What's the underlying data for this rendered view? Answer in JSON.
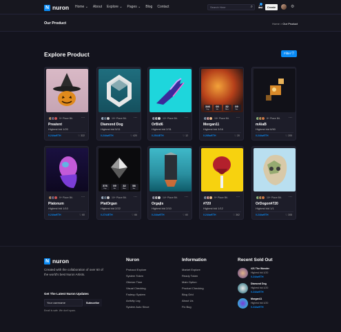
{
  "brand": {
    "name": "nuron",
    "mark": "N"
  },
  "nav": {
    "items": [
      "Home ⌄",
      "About",
      "Explore ⌄",
      "Pages ⌄",
      "Blog",
      "Contact"
    ]
  },
  "search": {
    "placeholder": "Search Here"
  },
  "notifications": {
    "count": "1"
  },
  "create_label": "Create",
  "title_area": {
    "title": "Our Product",
    "crumb_home": "Home",
    "crumb_sep": ">",
    "crumb_current": "Our Product"
  },
  "section": {
    "title": "Explore Product",
    "filter_label": "Filter ⛉"
  },
  "cards": [
    {
      "place": "9+ Place Bit.",
      "name": "Preatent",
      "bid": "Highest bid 1/20",
      "price": "0.244wETH",
      "likes": "♡ 322"
    },
    {
      "place": "10+ Place Bit.",
      "name": "Diamond Dog",
      "bid": "Highest bid 5/11",
      "price": "0.244wETH",
      "likes": "♡ 420"
    },
    {
      "place": "12+ Place Bit.",
      "name": "OrBid6",
      "bid": "Highest bid 2/31",
      "price": "0.2544ETH",
      "likes": "♡ 12"
    },
    {
      "place": "15+ Place Bit.",
      "name": "Morgan11",
      "bid": "Highest bid 3/16",
      "price": "0.265wETH",
      "likes": "♡ 20"
    },
    {
      "place": "8+ Place Bit.",
      "name": "mAiaB",
      "bid": "Highest bid 6/50",
      "price": "0.244wETH",
      "likes": "♡ 205"
    },
    {
      "place": "9+ Place Bit.",
      "name": "Platonum",
      "bid": "Highest bid 1/10",
      "price": "0.244wETH",
      "likes": "♡ 60"
    },
    {
      "place": "10+ Place Bit.",
      "name": "PlatOrgan",
      "bid": "Highest bid 2/22",
      "price": "0.2744ETH",
      "likes": "♡ 66"
    },
    {
      "place": "14+ Place Bit.",
      "name": "Orgajis",
      "bid": "Highest bid 2/10",
      "price": "0.244wETH",
      "likes": "♡ 60"
    },
    {
      "place": "9+ Place Bit.",
      "name": "#720",
      "bid": "Highest bid 1/12",
      "price": "0.244wETH",
      "likes": "♡ 362"
    },
    {
      "place": "10+ Place Bit.",
      "name": "OrDogon#720",
      "bid": "Highest bid 1/1",
      "price": "0.244wETH",
      "likes": "♡ 308"
    }
  ],
  "countdowns": [
    {
      "values": [
        "346",
        "00",
        "32",
        "09"
      ],
      "labels": [
        "Day",
        "Hrs",
        "Mins",
        "Sec"
      ]
    },
    {
      "values": [
        "376",
        "09",
        "32",
        "58"
      ],
      "labels": [
        "Day",
        "Hrs",
        "Mins",
        "Sec"
      ]
    }
  ],
  "footer": {
    "description": "Created with the collaboration of over 60 of the world's best Nuron Artists.",
    "updates_title": "Get The Latest Nuron Updates",
    "email_value": "Your username",
    "subscribe_label": "Subscribe",
    "note": "Email is safe. We don't spam.",
    "col1": {
      "title": "Nuron",
      "links": [
        "Protocol Explore",
        "System Token",
        "Otimize Time",
        "Visual Checking",
        "Fadeup System",
        "Activity Log",
        "System Auto Since"
      ]
    },
    "col2": {
      "title": "Information",
      "links": [
        "Market Explore",
        "Ready Token",
        "Main Option",
        "Product Checking",
        "Blog Grid",
        "About Us",
        "Fix Bug"
      ]
    },
    "col3": {
      "title": "Recent Sold Out",
      "items": [
        {
          "name": "#21 The Wonder",
          "bid": "Highest bid 1/20",
          "price": "0.244wETH"
        },
        {
          "name": "Diamond Dog",
          "bid": "Highest bid 1/20",
          "price": "0.244wETH"
        },
        {
          "name": "Morgan11",
          "bid": "Highest bid 1/20",
          "price": "0.244wETH"
        }
      ]
    }
  },
  "colors": {
    "accent": "#0a8bf5",
    "background": "#13131d",
    "card": "#1d1d29"
  }
}
